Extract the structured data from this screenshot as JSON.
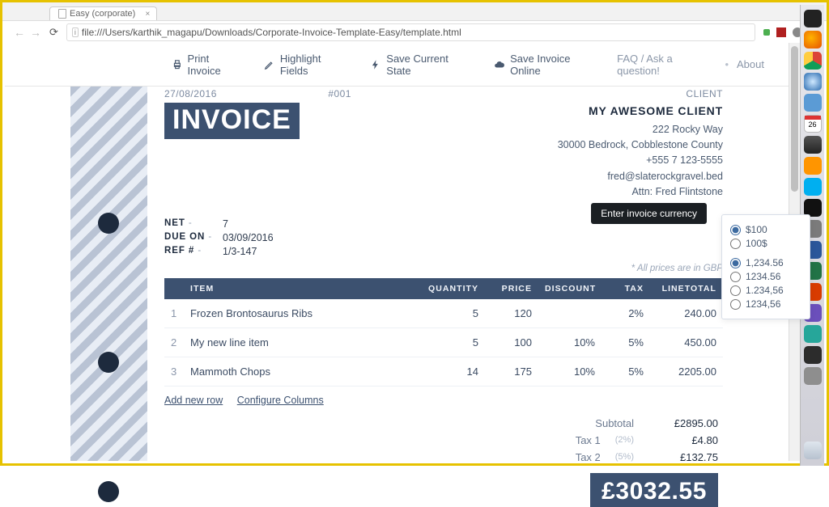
{
  "browser": {
    "tab_title": "Easy (corporate)",
    "url": "file:///Users/karthik_magapu/Downloads/Corporate-Invoice-Template-Easy/template.html"
  },
  "dock": {
    "calendar_day": "26"
  },
  "toolbar": {
    "print": "Print Invoice",
    "highlight": "Highlight Fields",
    "save_state": "Save Current State",
    "save_online": "Save Invoice Online",
    "faq": "FAQ / Ask a question!",
    "about": "About"
  },
  "header": {
    "date": "27/08/2016",
    "number": "#001",
    "client_label": "CLIENT",
    "logo": "INVOICE"
  },
  "client": {
    "name": "MY AWESOME CLIENT",
    "street": "222 Rocky Way",
    "city": "30000 Bedrock, Cobblestone County",
    "phone": "+555 7 123-5555",
    "email": "fred@slaterockgravel.bed",
    "attn": "Attn: Fred Flintstone"
  },
  "meta": {
    "net_label": "NET",
    "net_value": "7",
    "due_label": "DUE ON",
    "due_value": "03/09/2016",
    "ref_label": "REF #",
    "ref_value": "1/3-147"
  },
  "price_note": "* All prices are in GBP",
  "tooltip": "Enter invoice currency",
  "currency_options": {
    "a": "$100",
    "b": "100$",
    "c": "1,234.56",
    "d": "1234.56",
    "e": "1.234,56",
    "f": "1234,56"
  },
  "columns": {
    "item": "ITEM",
    "qty": "QUANTITY",
    "price": "PRICE",
    "discount": "DISCOUNT",
    "tax": "TAX",
    "linetotal": "LINETOTAL"
  },
  "rows": [
    {
      "idx": "1",
      "name": "Frozen Brontosaurus Ribs",
      "qty": "5",
      "price": "120",
      "discount": "",
      "tax": "2%",
      "total": "240.00"
    },
    {
      "idx": "2",
      "name": "My new line item",
      "qty": "5",
      "price": "100",
      "discount": "10%",
      "tax": "5%",
      "total": "450.00"
    },
    {
      "idx": "3",
      "name": "Mammoth Chops",
      "qty": "14",
      "price": "175",
      "discount": "10%",
      "tax": "5%",
      "total": "2205.00"
    }
  ],
  "actions": {
    "add": "Add new row",
    "configure": "Configure Columns"
  },
  "totals": {
    "subtotal_label": "Subtotal",
    "subtotal": "£2895.00",
    "tax1_label": "Tax 1",
    "tax1_pct": "(2%)",
    "tax1": "£4.80",
    "tax2_label": "Tax 2",
    "tax2_pct": "(5%)",
    "tax2": "£132.75",
    "grand": "£3032.55"
  }
}
